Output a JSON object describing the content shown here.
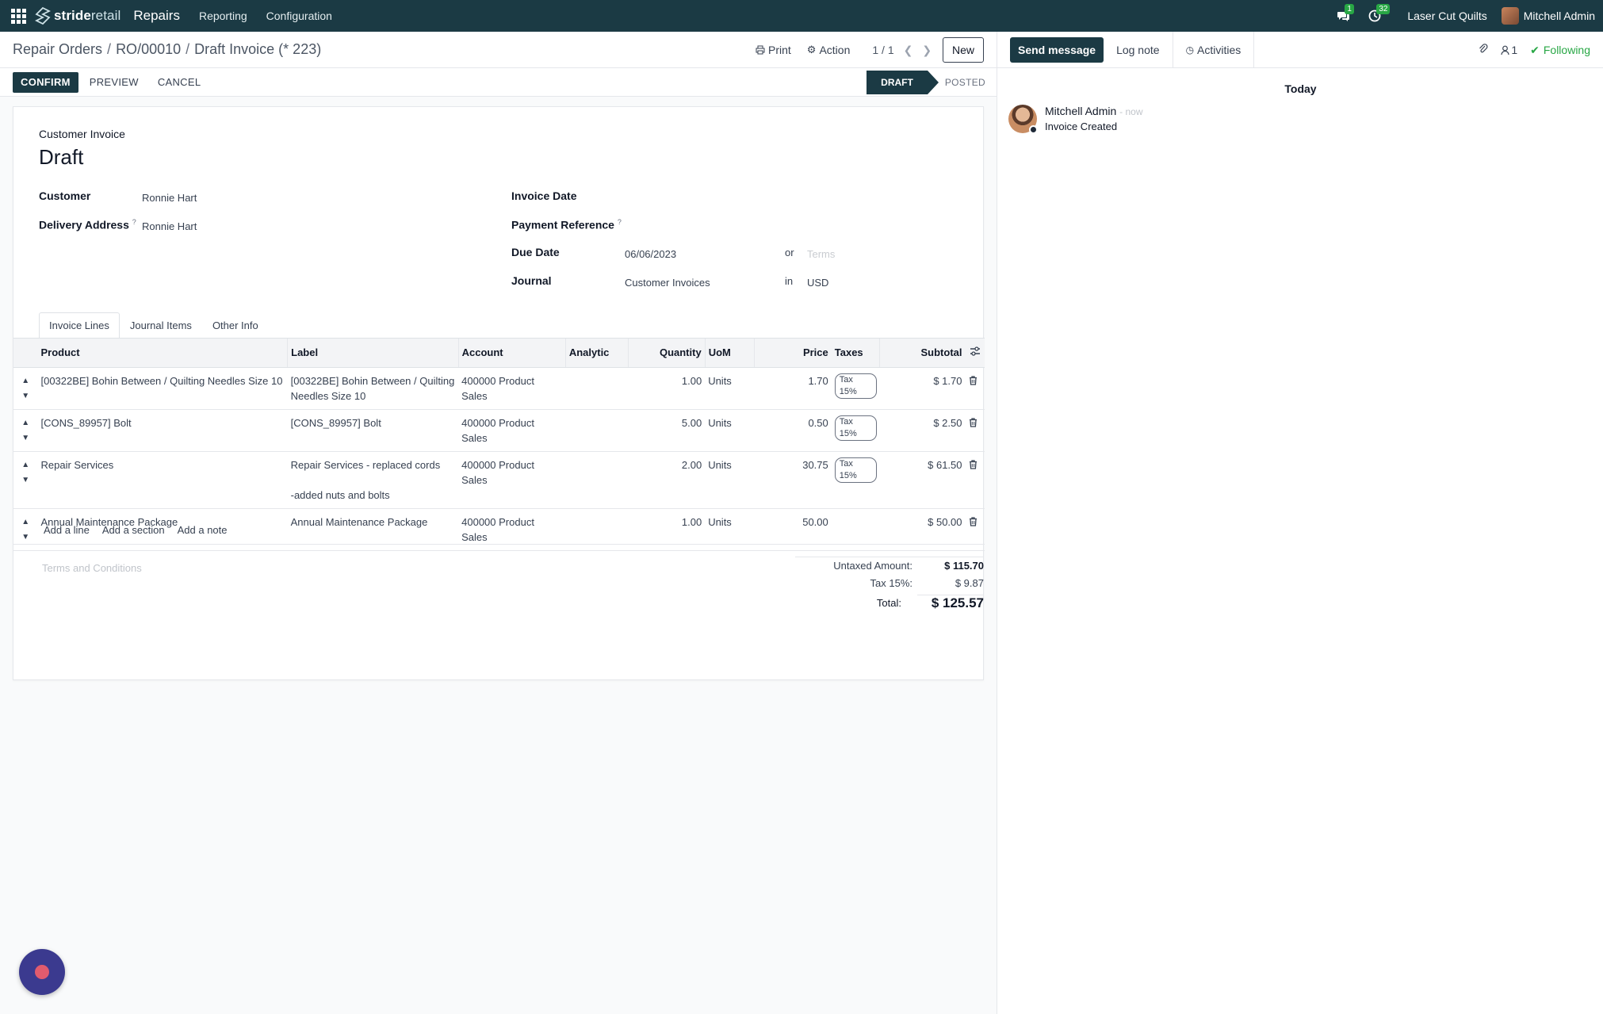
{
  "navbar": {
    "brand_strong": "stride",
    "brand_rest": "retail",
    "app_name": "Repairs",
    "menus": [
      "Reporting",
      "Configuration"
    ],
    "messages_count": "1",
    "activities_count": "32",
    "company": "Laser Cut Quilts",
    "user": "Mitchell Admin"
  },
  "control": {
    "breadcrumb": [
      "Repair Orders",
      "RO/00010",
      "Draft Invoice (* 223)"
    ],
    "print": "Print",
    "action": "Action",
    "pager": "1 / 1",
    "new": "New"
  },
  "status": {
    "confirm": "CONFIRM",
    "preview": "PREVIEW",
    "cancel": "CANCEL",
    "stage_current": "DRAFT",
    "stage_next": "POSTED"
  },
  "form": {
    "subtitle": "Customer Invoice",
    "title": "Draft",
    "customer_label": "Customer",
    "customer": "Ronnie Hart",
    "delivery_label": "Delivery Address",
    "delivery": "Ronnie Hart",
    "invoice_date_label": "Invoice Date",
    "payment_ref_label": "Payment Reference",
    "due_date_label": "Due Date",
    "due_date": "06/06/2023",
    "or": "or",
    "terms_placeholder": "Terms",
    "journal_label": "Journal",
    "journal": "Customer Invoices",
    "in": "in",
    "currency": "USD",
    "help_mark": "?"
  },
  "tabs": [
    "Invoice Lines",
    "Journal Items",
    "Other Info"
  ],
  "table": {
    "columns": [
      "Product",
      "Label",
      "Account",
      "Analytic",
      "Quantity",
      "UoM",
      "Price",
      "Taxes",
      "Subtotal"
    ],
    "rows": [
      {
        "product": "[00322BE] Bohin Between / Quilting Needles Size 10",
        "label_1": "[00322BE] Bohin Between / Quilting",
        "label_2": "Needles Size 10",
        "account": "400000 Product Sales",
        "analytic": "",
        "quantity": "1.00",
        "uom": "Units",
        "price": "1.70",
        "tax": "Tax 15%",
        "subtotal": "$ 1.70"
      },
      {
        "product": "[CONS_89957] Bolt",
        "label_1": "[CONS_89957] Bolt",
        "label_2": "",
        "account": "400000 Product Sales",
        "analytic": "",
        "quantity": "5.00",
        "uom": "Units",
        "price": "0.50",
        "tax": "Tax 15%",
        "subtotal": "$ 2.50"
      },
      {
        "product": "Repair Services",
        "label_1": "Repair Services - replaced cords",
        "label_2": "-added nuts and bolts",
        "account": "400000 Product Sales",
        "analytic": "",
        "quantity": "2.00",
        "uom": "Units",
        "price": "30.75",
        "tax": "Tax 15%",
        "subtotal": "$ 61.50"
      },
      {
        "product": "Annual Maintenance Package",
        "label_1": "Annual Maintenance Package",
        "label_2": "",
        "account": "400000 Product Sales",
        "analytic": "",
        "quantity": "1.00",
        "uom": "Units",
        "price": "50.00",
        "tax": "",
        "subtotal": "$ 50.00"
      }
    ],
    "add_line": "Add a line",
    "add_section": "Add a section",
    "add_note": "Add a note"
  },
  "terms": "Terms and Conditions",
  "totals": {
    "untaxed_label": "Untaxed Amount:",
    "untaxed": "$ 115.70",
    "tax_label": "Tax 15%:",
    "tax": "$ 9.87",
    "total_label": "Total:",
    "total": "$ 125.57"
  },
  "chatter": {
    "send_message": "Send message",
    "log_note": "Log note",
    "activities": "Activities",
    "followers_count": "1",
    "following": "Following",
    "day": "Today",
    "message": {
      "author": "Mitchell Admin",
      "time": "- now",
      "body": "Invoice Created"
    }
  },
  "colors": {
    "primary": "#1b3a44",
    "success": "#28a745",
    "livechat": "#3b3a8f"
  }
}
